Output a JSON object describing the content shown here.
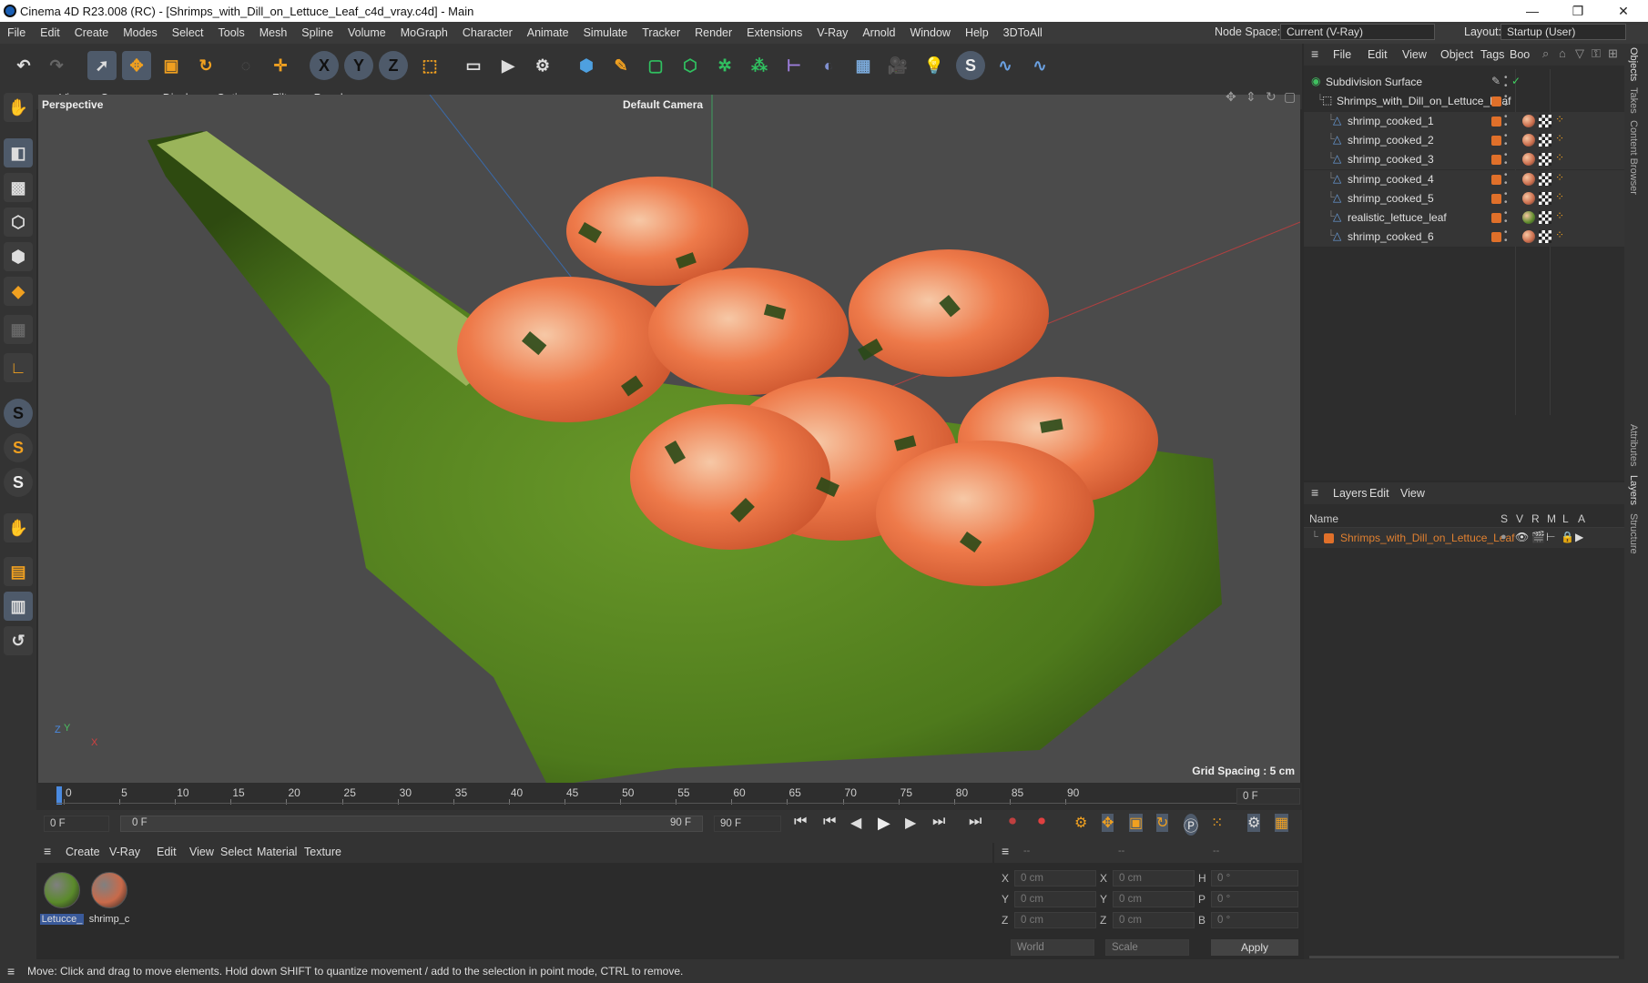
{
  "window": {
    "title": "Cinema 4D R23.008 (RC) - [Shrimps_with_Dill_on_Lettuce_Leaf_c4d_vray.c4d] - Main",
    "min": "—",
    "max": "❐",
    "close": "✕"
  },
  "menu": [
    "File",
    "Edit",
    "Create",
    "Modes",
    "Select",
    "Tools",
    "Mesh",
    "Spline",
    "Volume",
    "MoGraph",
    "Character",
    "Animate",
    "Simulate",
    "Tracker",
    "Render",
    "Extensions",
    "V-Ray",
    "Arnold",
    "Window",
    "Help",
    "3DToAll"
  ],
  "node_space": {
    "label": "Node Space:",
    "value": "Current (V-Ray)"
  },
  "layout": {
    "label": "Layout:",
    "value": "Startup (User)"
  },
  "viewport": {
    "menu": [
      "View",
      "Cameras",
      "Display",
      "Options",
      "Filter",
      "Panel"
    ],
    "projection": "Perspective",
    "camera": "Default Camera",
    "grid_spacing": "Grid Spacing : 5 cm",
    "axes": {
      "x": "X",
      "y": "Y",
      "z": "Z"
    }
  },
  "objects_panel": {
    "menu": [
      "File",
      "Edit",
      "View",
      "Object",
      "Tags",
      "Boo"
    ],
    "items": [
      {
        "name": "Subdivision Surface",
        "indent": 0
      },
      {
        "name": "Shrimps_with_Dill_on_Lettuce_Leaf",
        "indent": 1
      },
      {
        "name": "shrimp_cooked_1",
        "indent": 2
      },
      {
        "name": "shrimp_cooked_2",
        "indent": 2
      },
      {
        "name": "shrimp_cooked_3",
        "indent": 2
      },
      {
        "name": "shrimp_cooked_4",
        "indent": 2
      },
      {
        "name": "shrimp_cooked_5",
        "indent": 2
      },
      {
        "name": "realistic_lettuce_leaf",
        "indent": 2
      },
      {
        "name": "shrimp_cooked_6",
        "indent": 2
      }
    ]
  },
  "layers_panel": {
    "menu": [
      "Layers",
      "Edit",
      "View"
    ],
    "header": {
      "name": "Name",
      "cols": [
        "S",
        "V",
        "R",
        "M",
        "L",
        "A"
      ]
    },
    "layer": "Shrimps_with_Dill_on_Lettuce_Leaf"
  },
  "side_tabs": [
    "Objects",
    "Takes",
    "Content Browser",
    "Attributes",
    "Layers",
    "Structure"
  ],
  "timeline": {
    "ticks": [
      "0",
      "5",
      "10",
      "15",
      "20",
      "25",
      "30",
      "35",
      "40",
      "45",
      "50",
      "55",
      "60",
      "65",
      "70",
      "75",
      "80",
      "85",
      "90"
    ],
    "current": "0 F",
    "field_start": "0 F",
    "range_start": "0 F",
    "range_end": "90 F",
    "field_end": "90 F"
  },
  "materials": {
    "menu": [
      "Create",
      "V-Ray",
      "Edit",
      "View",
      "Select",
      "Material",
      "Texture"
    ],
    "items": [
      {
        "name": "Letucce_",
        "color": "#5a8a2a"
      },
      {
        "name": "shrimp_c",
        "color": "#c86a4a"
      }
    ]
  },
  "coords": {
    "rows": [
      {
        "a": "X",
        "av": "0 cm",
        "b": "X",
        "bv": "0 cm",
        "c": "H",
        "cv": "0 °"
      },
      {
        "a": "Y",
        "av": "0 cm",
        "b": "Y",
        "bv": "0 cm",
        "c": "P",
        "cv": "0 °"
      },
      {
        "a": "Z",
        "av": "0 cm",
        "b": "Z",
        "bv": "0 cm",
        "c": "B",
        "cv": "0 °"
      }
    ],
    "dashes": [
      "--",
      "--",
      "--"
    ],
    "world": "World",
    "scale": "Scale",
    "apply": "Apply"
  },
  "status": "Move: Click and drag to move elements. Hold down SHIFT to quantize movement / add to the selection in point mode, CTRL to remove."
}
